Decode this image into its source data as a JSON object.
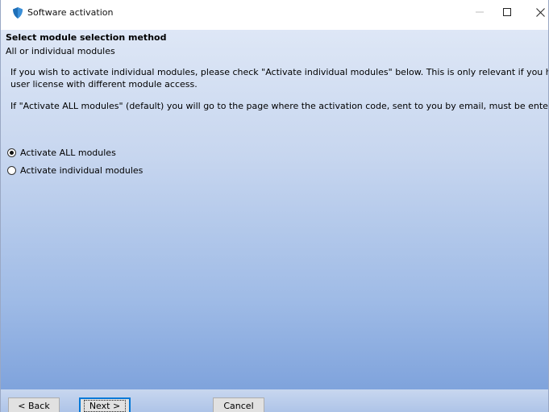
{
  "window": {
    "title": "Software activation"
  },
  "titlebar": {
    "min_icon": "minimize-icon",
    "max_icon": "maximize-icon",
    "close_icon": "close-icon"
  },
  "page": {
    "heading": "Select module selection method",
    "subheading": "All or individual modules",
    "paragraph1_line1": "If you wish to activate individual modules, please check \"Activate individual modules\" below. This is only relevant if you have a multi",
    "paragraph1_line2": "user license with different module access.",
    "paragraph2": "If \"Activate ALL modules\" (default) you will go to the page where the activation code, sent to you by email, must be entered."
  },
  "options": {
    "all_label": "Activate ALL modules",
    "all_selected": true,
    "individual_label": "Activate individual modules",
    "individual_selected": false
  },
  "buttons": {
    "back": "< Back",
    "next": "Next >",
    "cancel": "Cancel"
  },
  "colors": {
    "accent_focus": "#0078d7",
    "gradient_top": "#dee7f6",
    "gradient_bottom": "#7fa3dc"
  }
}
